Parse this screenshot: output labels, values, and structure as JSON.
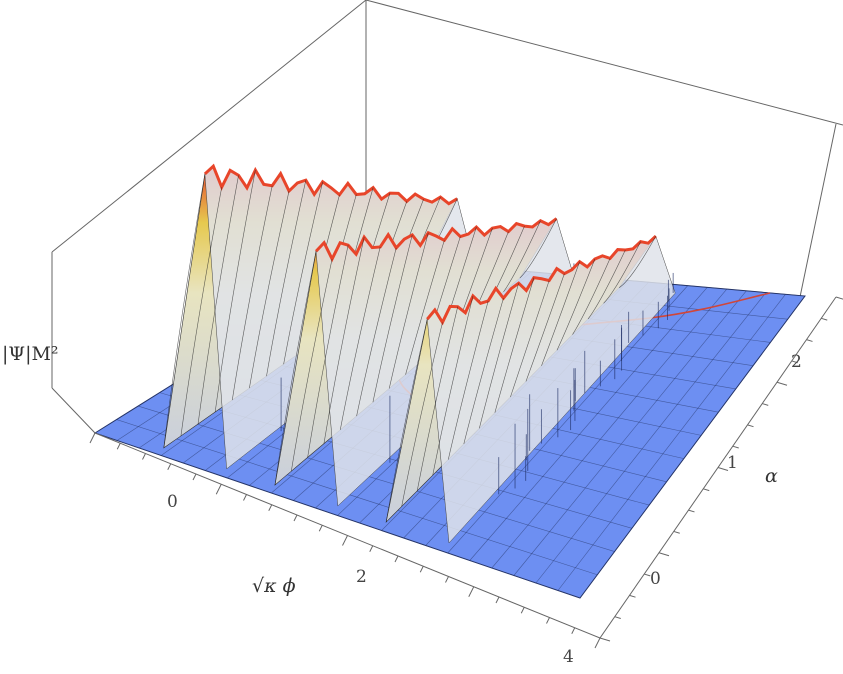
{
  "chart_data": {
    "type": "surface3d",
    "title": "",
    "zlabel": "|Ψ|M²",
    "xlabel": "√κ ϕ",
    "ylabel": "α",
    "x_ticks": [
      "0",
      "2",
      "4"
    ],
    "y_ticks": [
      "0",
      "1",
      "2"
    ],
    "colors": {
      "plane": "#6d8ff2",
      "plane_grid": "#20305f",
      "surface_low": "#d9dde8",
      "surface_mid": "#e9d36a",
      "surface_high": "#e8452a",
      "curve": "#d0463a",
      "box": "#555555"
    },
    "ridges": [
      {
        "name": "",
        "position": 0.0
      },
      {
        "name": "",
        "position": 1.5
      },
      {
        "name": "",
        "position": 3.0
      }
    ]
  }
}
